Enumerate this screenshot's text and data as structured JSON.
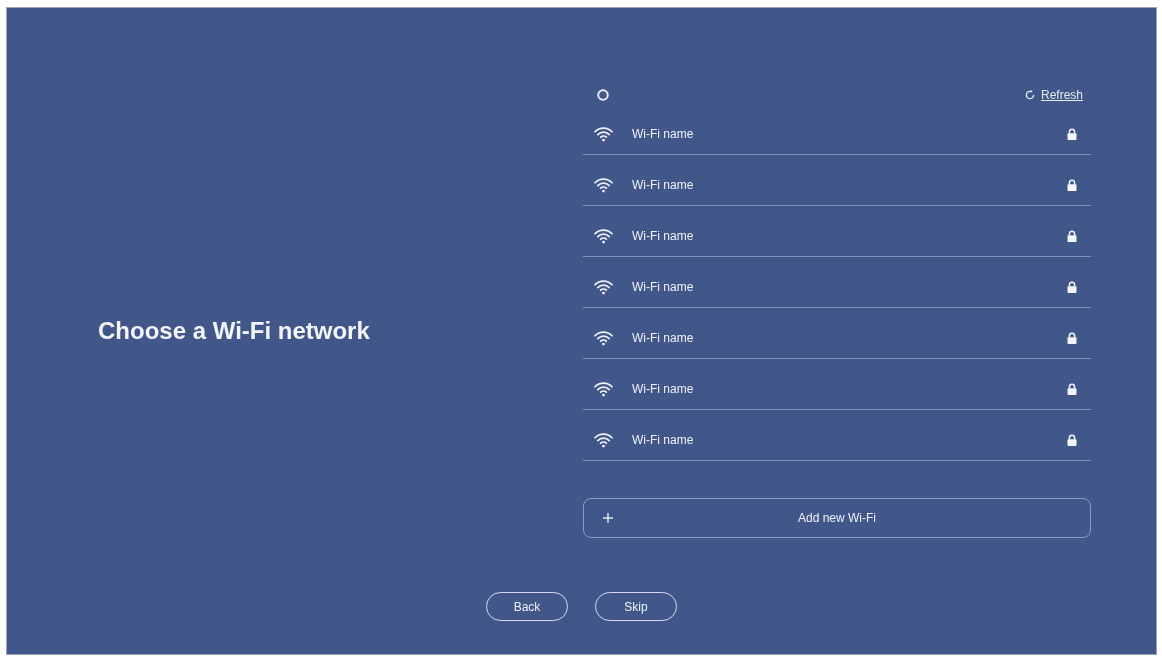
{
  "title": "Choose a Wi-Fi network",
  "toolbar": {
    "scanning": true,
    "refresh_label": "Refresh"
  },
  "networks": [
    {
      "name": "Wi-Fi name",
      "secured": true
    },
    {
      "name": "Wi-Fi name",
      "secured": true
    },
    {
      "name": "Wi-Fi name",
      "secured": true
    },
    {
      "name": "Wi-Fi name",
      "secured": true
    },
    {
      "name": "Wi-Fi name",
      "secured": true
    },
    {
      "name": "Wi-Fi name",
      "secured": true
    },
    {
      "name": "Wi-Fi name",
      "secured": true
    }
  ],
  "add_button": {
    "label": "Add new Wi-Fi"
  },
  "footer_buttons": [
    {
      "label": "Back"
    },
    {
      "label": "Skip"
    }
  ]
}
